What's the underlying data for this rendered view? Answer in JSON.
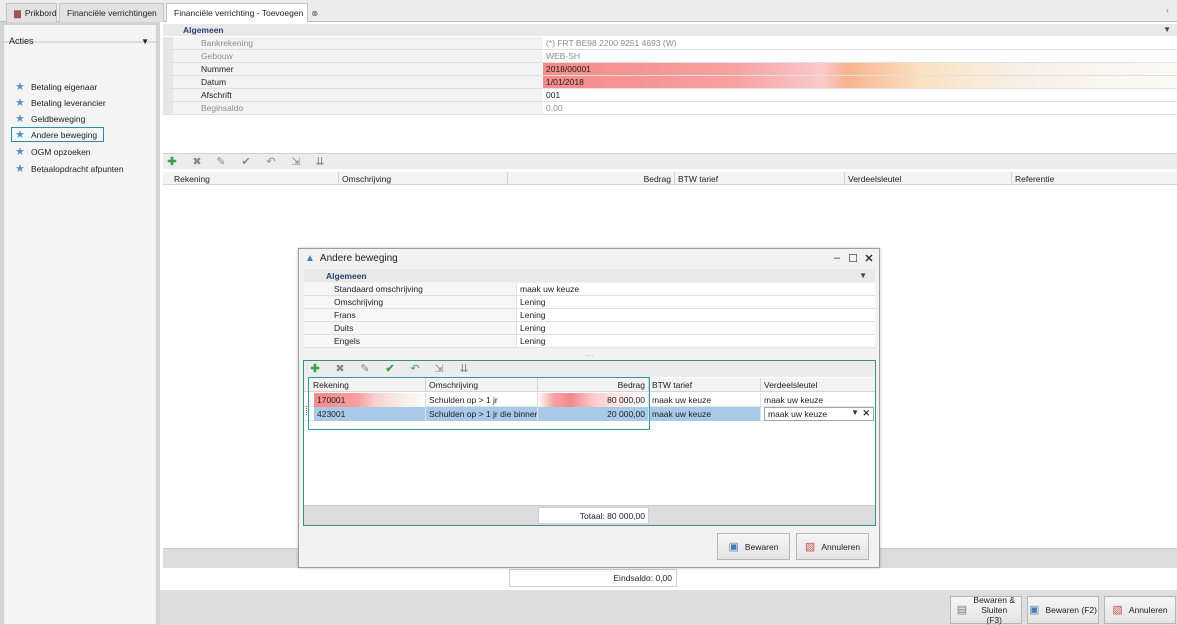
{
  "tabs": [
    {
      "label": "Prikbord",
      "icon": "briefcase-icon"
    },
    {
      "label": "Financiële verrichtingen"
    },
    {
      "label": "Financiële verrichting - Toevoegen",
      "close": "⊗"
    }
  ],
  "sidebar": {
    "title": "Acties",
    "items": [
      {
        "label": "Betaling eigenaar"
      },
      {
        "label": "Betaling leverancier"
      },
      {
        "label": "Geldbeweging"
      },
      {
        "label": "Andere beweging"
      },
      {
        "label": "OGM opzoeken"
      },
      {
        "label": "Betaalopdracht afpunten"
      }
    ]
  },
  "form": {
    "section": "Algemeen",
    "rows": [
      {
        "label": "Bankrekening",
        "value": "(*) FRT BE98 2200 9251 4693 (W)"
      },
      {
        "label": "Gebouw",
        "value": "WEB-SH"
      },
      {
        "label": "Nummer",
        "value": "2018/00001"
      },
      {
        "label": "Datum",
        "value": "1/01/2018"
      },
      {
        "label": "Afschrift",
        "value": "001"
      },
      {
        "label": "Beginsaldo",
        "value": "0,00"
      }
    ]
  },
  "grid": {
    "columns": [
      "Rekening",
      "Omschrijving",
      "Bedrag",
      "BTW tarief",
      "Verdeelsleutel",
      "Referentie"
    ]
  },
  "eindsaldo": "Eindsaldo: 0,00",
  "bottom_buttons": {
    "save_close": "Bewaren & Sluiten (F3)",
    "save": "Bewaren (F2)",
    "cancel": "Annuleren"
  },
  "dialog": {
    "title": "Andere beweging",
    "section": "Algemeen",
    "rows": [
      {
        "label": "Standaard omschrijving",
        "value": "maak uw keuze"
      },
      {
        "label": "Omschrijving",
        "value": "Lening"
      },
      {
        "label": "Frans",
        "value": "Lening"
      },
      {
        "label": "Duits",
        "value": "Lening"
      },
      {
        "label": "Engels",
        "value": "Lening"
      }
    ],
    "grid": {
      "columns": [
        "Rekening",
        "Omschrijving",
        "Bedrag",
        "BTW tarief",
        "Verdeelsleutel"
      ],
      "rows": [
        {
          "rekening": "170001",
          "omschrijving": "Schulden op > 1 jr",
          "bedrag": "80 000,00",
          "btw": "maak uw keuze",
          "verdeel": "maak uw keuze"
        },
        {
          "rekening": "423001",
          "omschrijving": "Schulden op > 1 jr die binnen ...",
          "bedrag": "20 000,00",
          "btw": "maak uw keuze",
          "verdeel": "maak uw keuze"
        }
      ]
    },
    "totaal": "Totaal: 80 000,00",
    "save": "Bewaren",
    "cancel": "Annuleren"
  },
  "colors": {
    "accent": "#2f97ad",
    "required": "#f58a8a",
    "selection": "#a9c9e8"
  }
}
